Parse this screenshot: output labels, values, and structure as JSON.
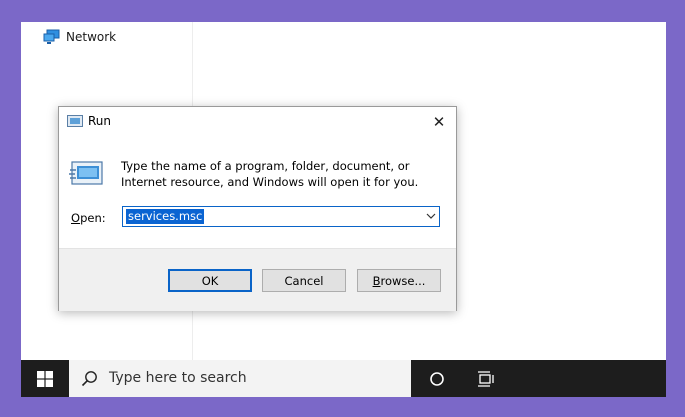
{
  "nav": {
    "network_label": "Network"
  },
  "dialog": {
    "title": "Run",
    "close_glyph": "✕",
    "description": "Type the name of a program, folder, document, or Internet resource, and Windows will open it for you.",
    "open_label_accel": "O",
    "open_label_rest": "pen:",
    "open_value": "services.msc",
    "buttons": {
      "ok": "OK",
      "cancel": "Cancel",
      "browse_accel": "B",
      "browse_rest": "rowse..."
    }
  },
  "taskbar": {
    "search_placeholder": "Type here to search"
  },
  "colors": {
    "desktop_frame": "#7b68c8",
    "taskbar": "#1d1d1d",
    "accent": "#0a64c8"
  }
}
